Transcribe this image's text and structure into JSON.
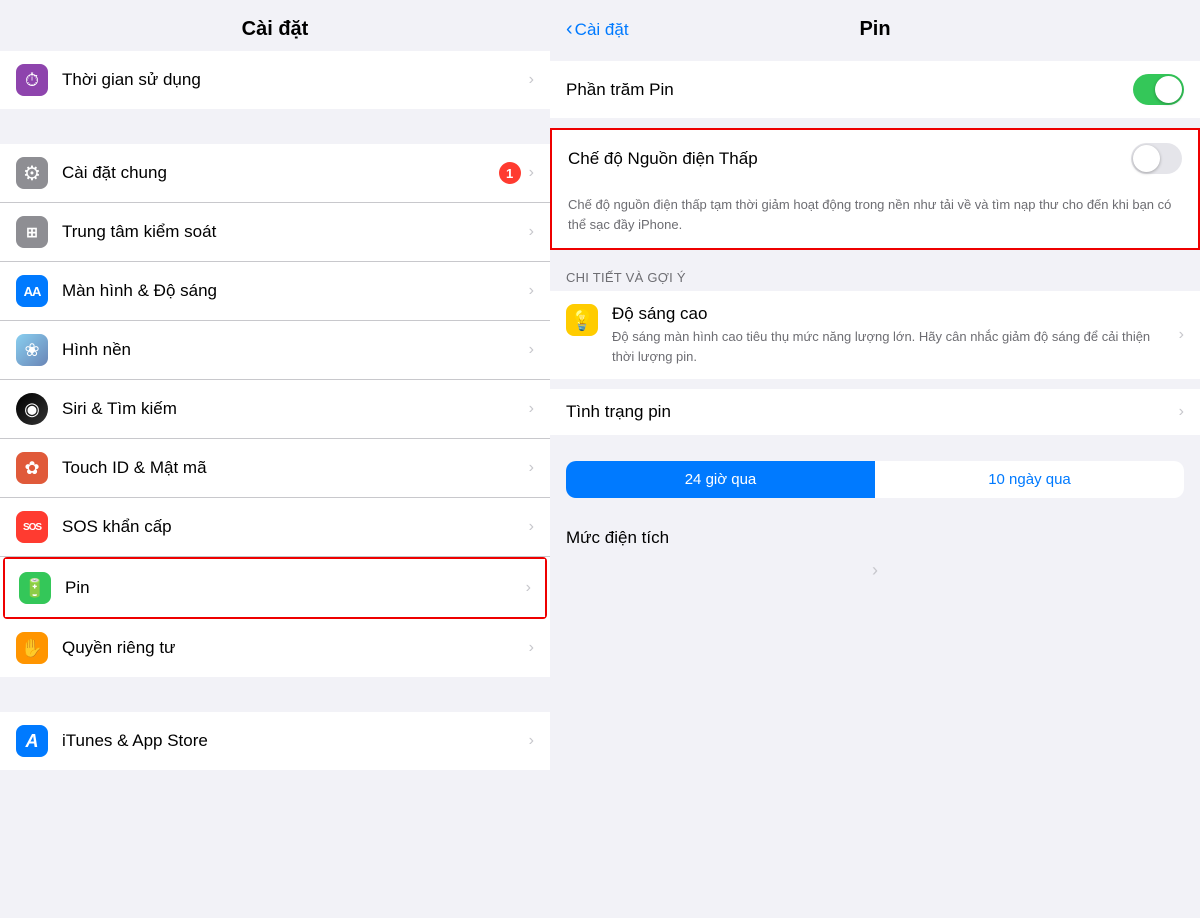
{
  "left": {
    "header": "Cài đặt",
    "groups": [
      {
        "items": [
          {
            "id": "screen-time",
            "icon": "⏱",
            "iconBg": "bg-purple",
            "label": "Thời gian sử dụng",
            "badge": null,
            "highlighted": false
          }
        ]
      },
      {
        "items": [
          {
            "id": "general",
            "icon": "⚙️",
            "iconBg": "bg-gray",
            "label": "Cài đặt chung",
            "badge": "1",
            "highlighted": false
          },
          {
            "id": "control-center",
            "icon": "⊞",
            "iconBg": "bg-gray",
            "label": "Trung tâm kiểm soát",
            "badge": null,
            "highlighted": false
          },
          {
            "id": "display",
            "icon": "AA",
            "iconBg": "bg-blue",
            "label": "Màn hình & Độ sáng",
            "badge": null,
            "highlighted": false
          },
          {
            "id": "wallpaper",
            "icon": "❀",
            "iconBg": "bg-blue",
            "label": "Hình nền",
            "badge": null,
            "highlighted": false
          },
          {
            "id": "siri",
            "icon": "◎",
            "iconBg": "bg-pink",
            "label": "Siri & Tìm kiếm",
            "badge": null,
            "highlighted": false
          },
          {
            "id": "touch-id",
            "icon": "✿",
            "iconBg": "bg-red-orange",
            "label": "Touch ID & Mật mã",
            "badge": null,
            "highlighted": false
          },
          {
            "id": "sos",
            "icon": "SOS",
            "iconBg": "bg-red",
            "label": "SOS khẩn cấp",
            "badge": null,
            "highlighted": false
          },
          {
            "id": "battery",
            "icon": "▬",
            "iconBg": "bg-green",
            "label": "Pin",
            "badge": null,
            "highlighted": true
          },
          {
            "id": "privacy",
            "icon": "✋",
            "iconBg": "bg-orange",
            "label": "Quyền riêng tư",
            "badge": null,
            "highlighted": false
          }
        ]
      },
      {
        "items": [
          {
            "id": "appstore",
            "icon": "A",
            "iconBg": "bg-blue-store",
            "label": "iTunes & App Store",
            "badge": null,
            "highlighted": false
          }
        ]
      }
    ]
  },
  "right": {
    "back_label": "Cài đặt",
    "title": "Pin",
    "items": [
      {
        "id": "phan-tram-pin",
        "label": "Phần trăm Pin",
        "toggle": "on"
      }
    ],
    "low_power": {
      "label": "Chế độ Nguồn điện Thấp",
      "toggle": "off",
      "description": "Chế độ nguồn điện thấp tạm thời giảm hoạt động trong nền như tải về và tìm nạp thư cho đến khi bạn có thể sạc đầy iPhone."
    },
    "section_header": "CHI TIẾT VÀ GỢI Ý",
    "brightness": {
      "title": "Độ sáng cao",
      "description": "Độ sáng màn hình cao tiêu thụ mức năng lượng lớn. Hãy cân nhắc giảm độ sáng để cải thiện thời lượng pin."
    },
    "tinh_trang_pin": "Tình trạng pin",
    "tabs": [
      {
        "label": "24 giờ qua",
        "active": true
      },
      {
        "label": "10 ngày qua",
        "active": false
      }
    ],
    "muc_dien_tich": "Mức điện tích"
  }
}
